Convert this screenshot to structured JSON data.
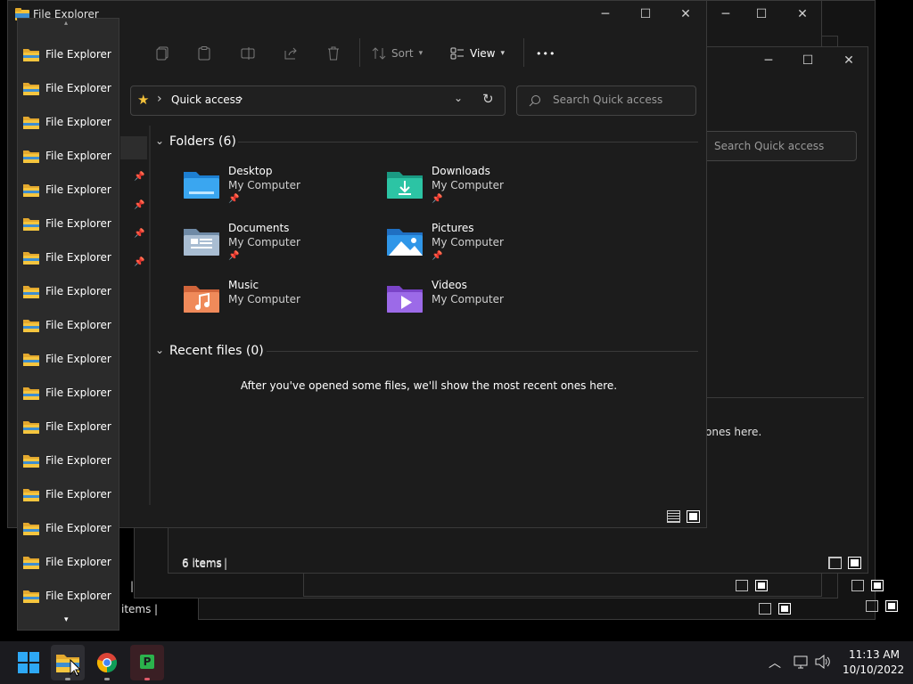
{
  "background_windows": {
    "search_placeholder": "Search Quick access",
    "recent_msg_tail": "ones here.",
    "status_items_tail_1": "items",
    "status_items_tail_2": "items",
    "status_sep": "|"
  },
  "window": {
    "title": "File Explorer",
    "toolbar": {
      "sort_label": "Sort",
      "view_label": "View",
      "more_label": "•••"
    },
    "address": {
      "location": "Quick access",
      "chevron_1": "›",
      "chevron_2": "›"
    },
    "search_placeholder": "Search Quick access",
    "folders_header": "Folders (6)",
    "folders": [
      {
        "name": "Desktop",
        "location": "My Computer",
        "pinned": true
      },
      {
        "name": "Downloads",
        "location": "My Computer",
        "pinned": true
      },
      {
        "name": "Documents",
        "location": "My Computer",
        "pinned": true
      },
      {
        "name": "Pictures",
        "location": "My Computer",
        "pinned": true
      },
      {
        "name": "Music",
        "location": "My Computer",
        "pinned": false
      },
      {
        "name": "Videos",
        "location": "My Computer",
        "pinned": false
      }
    ],
    "recent_header": "Recent files (0)",
    "recent_empty_msg": "After you've opened some files, we'll show the most recent ones here.",
    "status_items": "6 items",
    "status_sep": "|"
  },
  "jump_list": {
    "items": [
      "File Explorer",
      "File Explorer",
      "File Explorer",
      "File Explorer",
      "File Explorer",
      "File Explorer",
      "File Explorer",
      "File Explorer",
      "File Explorer",
      "File Explorer",
      "File Explorer",
      "File Explorer",
      "File Explorer",
      "File Explorer",
      "File Explorer",
      "File Explorer",
      "File Explorer"
    ]
  },
  "taskbar": {
    "time": "11:13 AM",
    "date": "10/10/2022"
  },
  "colors": {
    "accent": "#4cc2ff",
    "folder_yellow": "#f3c13a",
    "window_bg": "#1c1c1c",
    "taskbar_bg": "#1b1b1f"
  }
}
